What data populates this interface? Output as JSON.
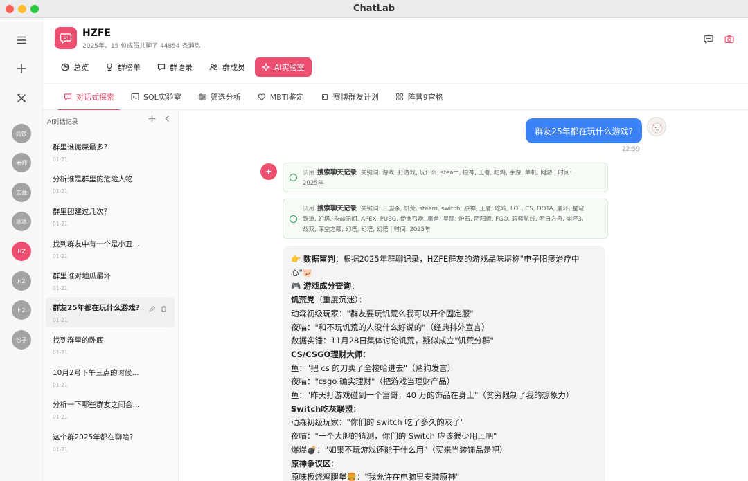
{
  "window": {
    "title": "ChatLab",
    "traffic": [
      "#fe5f57",
      "#febc2e",
      "#28c840"
    ]
  },
  "rail": {
    "avatars": [
      "约饭",
      "老师",
      "志强",
      "冰冰",
      "HZ",
      "H2",
      "H2",
      "饺子"
    ],
    "active_index": 4
  },
  "group": {
    "name": "HZFE",
    "subtitle": "2025年，15 位成员共聊了 44854 条消息"
  },
  "nav": [
    "总览",
    "群榜单",
    "群语录",
    "群成员",
    "AI实验室"
  ],
  "subtabs": [
    "对话式探索",
    "SQL实验室",
    "筛选分析",
    "MBTI鉴定",
    "赛博群友计划",
    "阵营9宫格"
  ],
  "history": {
    "header": "AI对话记录",
    "items": [
      {
        "title": "群里谁搬屎最多?",
        "date": "01-21"
      },
      {
        "title": "分析谁是群里的危险人物",
        "date": "01-21"
      },
      {
        "title": "群里团建过几次？",
        "date": "01-21"
      },
      {
        "title": "找到群友中有一个是小丑...",
        "date": "01-21"
      },
      {
        "title": "群里谁对地瓜最坏",
        "date": "01-21"
      },
      {
        "title": "群友25年都在玩什么游戏?",
        "date": "01-21"
      },
      {
        "title": "找到群里的卧底",
        "date": "01-21"
      },
      {
        "title": "10月2号下午三点的时候...",
        "date": "01-21"
      },
      {
        "title": "分析一下哪些群友之间会...",
        "date": "01-21"
      },
      {
        "title": "这个群2025年都在聊啥?",
        "date": "01-21"
      }
    ]
  },
  "chat": {
    "user_message": "群友25年都在玩什么游戏?",
    "user_time": "22:59",
    "tools": [
      {
        "prefix": "调用",
        "name": "搜索聊天记录",
        "line1": "关键词: 游戏, 打游戏, 玩什么, steam, 原神, 王者, 吃鸡, 手游, 单机, 网游 | 时间:",
        "line2": "2025年",
        "line3": ""
      },
      {
        "prefix": "调用",
        "name": "搜索聊天记录",
        "line1": "关键词: 三国杀, 饥荒, steam, switch, 原神, 王者, 吃鸡, LOL, CS, DOTA, 崩坏, 星穹",
        "line2": "铁道, 幻塔, 永劫无间, APEX, PUBG, 使命召唤, 魔兽, 星际, 炉石, 阴阳师, FGO, 碧蓝航线, 明日方舟, 崩坏3,",
        "line3": "战双, 深空之眼, 幻塔, 幻塔, 幻塔 | 时间: 2025年"
      }
    ],
    "answer": {
      "l1_label": "数据审判",
      "l1_text": "：根据2025年群聊记录，HZFE群友的游戏品味堪称\"电子阳痿治疗中",
      "l2": "心\"🐷",
      "l3": "游戏成分查询",
      "l3_tail": "：",
      "l4_label": "饥荒党",
      "l4_text": "（重度沉迷）：",
      "l5": "动森初级玩家：\"群友要玩饥荒么我可以开个固定服\"",
      "l6": "夜喵：\"和不玩饥荒的人没什么好说的\"（经典排外宣言）",
      "l7": "数据实锤：11月28日集体讨论饥荒，疑似成立\"饥荒分群\"",
      "l8": "CS/CSGO理财大师",
      "l8_tail": "：",
      "l9": "鱼：\"把 cs 的刀卖了全梭哈进去\"（赌狗发言）",
      "l10": "夜喵：\"csgo 确实理财\"（把游戏当理财产品）",
      "l11": "鱼：\"昨天打游戏碰到一个富哥，40 万的饰品在身上\"（贫穷限制了我的想象力）",
      "l12": "Switch吃灰联盟",
      "l12_tail": "：",
      "l13": "动森初级玩家：\"你们的 switch 吃了多久的灰了\"",
      "l14": "夜喵：\"一个大胆的猜测，你们的 Switch 应该很少用上吧\"",
      "l15": "爆爆💣：\"如果不玩游戏还能干什么用\"（买来当装饰品是吧）",
      "l16": "原神争议区",
      "l16_tail": "：",
      "l17": "原味板烧鸡腿堡🍔：\"我允许在电脑里安装原神\""
    }
  },
  "colors": {
    "accent": "#ec4f6f",
    "user_bubble": "#3b82f6",
    "tool_ok": "#2f9e55"
  }
}
